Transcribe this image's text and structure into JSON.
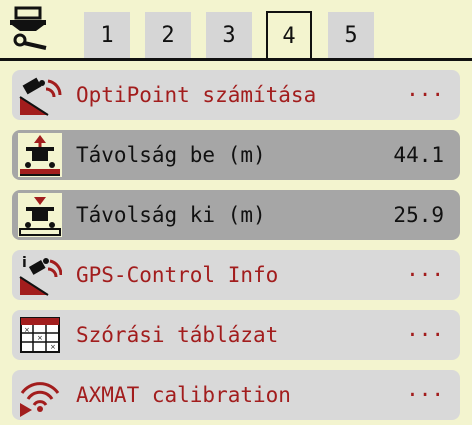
{
  "tabs": [
    {
      "label": "1",
      "active": false
    },
    {
      "label": "2",
      "active": false
    },
    {
      "label": "3",
      "active": false
    },
    {
      "label": "4",
      "active": true
    },
    {
      "label": "5",
      "active": false
    }
  ],
  "menu": [
    {
      "label": "OptiPoint számítása",
      "value": "···",
      "icon": "optipoint-icon",
      "selected": false
    },
    {
      "label": "Távolság be (m)",
      "value": "44.1",
      "icon": "distance-on-icon",
      "selected": true
    },
    {
      "label": "Távolság ki (m)",
      "value": "25.9",
      "icon": "distance-off-icon",
      "selected": true
    },
    {
      "label": "GPS-Control Info",
      "value": "···",
      "icon": "gps-info-icon",
      "selected": false
    },
    {
      "label": "Szórási táblázat",
      "value": "···",
      "icon": "spread-table-icon",
      "selected": false
    },
    {
      "label": "AXMAT calibration",
      "value": "···",
      "icon": "axmat-icon",
      "selected": false
    }
  ],
  "colors": {
    "background": "#f3f4cf",
    "text_accent": "#a21d1d",
    "row": "#d9d9d9",
    "row_selected": "#a6a6a6"
  }
}
